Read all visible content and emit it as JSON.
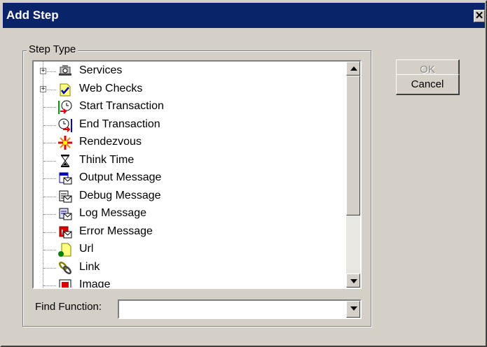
{
  "window": {
    "title": "Add Step"
  },
  "group": {
    "legend": "Step Type"
  },
  "tree": {
    "items": [
      {
        "label": "Services",
        "icon": "services-icon",
        "expandable": true
      },
      {
        "label": "Web Checks",
        "icon": "web-checks-icon",
        "expandable": true
      },
      {
        "label": "Start Transaction",
        "icon": "start-transaction-icon",
        "expandable": false
      },
      {
        "label": "End Transaction",
        "icon": "end-transaction-icon",
        "expandable": false
      },
      {
        "label": "Rendezvous",
        "icon": "rendezvous-icon",
        "expandable": false
      },
      {
        "label": "Think Time",
        "icon": "hourglass-icon",
        "expandable": false
      },
      {
        "label": "Output Message",
        "icon": "output-message-icon",
        "expandable": false
      },
      {
        "label": "Debug Message",
        "icon": "debug-message-icon",
        "expandable": false
      },
      {
        "label": "Log Message",
        "icon": "log-message-icon",
        "expandable": false
      },
      {
        "label": "Error Message",
        "icon": "error-message-icon",
        "expandable": false
      },
      {
        "label": "Url",
        "icon": "url-icon",
        "expandable": false
      },
      {
        "label": "Link",
        "icon": "link-icon",
        "expandable": false
      },
      {
        "label": "Image",
        "icon": "image-icon",
        "expandable": false
      }
    ],
    "expand_symbol": "+"
  },
  "find": {
    "label": "Find Function:",
    "value": ""
  },
  "buttons": {
    "ok": "OK",
    "cancel": "Cancel",
    "close_glyph": "✕"
  }
}
